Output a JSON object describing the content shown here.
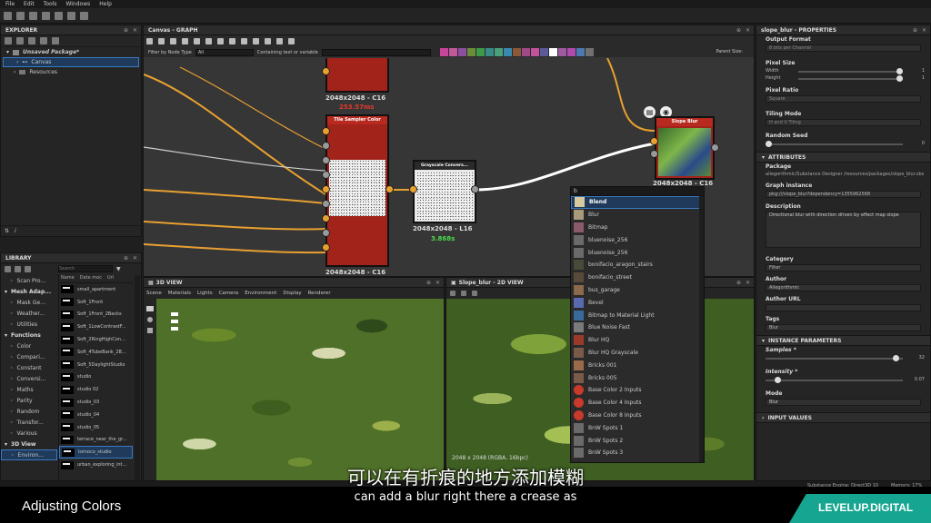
{
  "menu": [
    "File",
    "Edit",
    "Tools",
    "Windows",
    "Help"
  ],
  "explorer": {
    "title": "EXPLORER",
    "package": "Unsaved Package*",
    "items": [
      "Canvas",
      "Resources"
    ]
  },
  "library": {
    "title": "LIBRARY",
    "search_placeholder": "Search",
    "columns": [
      "Name",
      "Date moc",
      "Url"
    ],
    "categories": [
      {
        "label": "Scan Pro..."
      },
      {
        "label": "Mesh Adap...",
        "header": true
      },
      {
        "label": "Mask Ge..."
      },
      {
        "label": "Weather..."
      },
      {
        "label": "Utilities"
      },
      {
        "label": "Functions",
        "header": true
      },
      {
        "label": "Color"
      },
      {
        "label": "Compari..."
      },
      {
        "label": "Constant"
      },
      {
        "label": "Conversi..."
      },
      {
        "label": "Maths"
      },
      {
        "label": "Parity"
      },
      {
        "label": "Random"
      },
      {
        "label": "Transfor..."
      },
      {
        "label": "Various"
      },
      {
        "label": "3D View",
        "header": true
      },
      {
        "label": "Environ..."
      }
    ],
    "items": [
      "small_apartment",
      "Soft_1Front",
      "Soft_1Front_2Backs",
      "Soft_1LowContrastF...",
      "Soft_2RingHighCon...",
      "Soft_4TubeBank_2B...",
      "Soft_5DaylightStudio",
      "studio",
      "studio 02",
      "studio_03",
      "studio_04",
      "studio_05",
      "terrace_near_the_gr...",
      "tomoco_studio",
      "urban_exploring_int..."
    ]
  },
  "canvas": {
    "title": "Canvas - GRAPH",
    "filter_label": "Filter by Node Type",
    "filter_value": "All",
    "contains_label": "Containing text or variable",
    "parent_size": "Parent Size:",
    "nodes": {
      "top_res": "2048x2048 - C16",
      "top_time": "253.57ms",
      "tile_title": "Tile Sampler Color",
      "tile_res": "2048x2048 - C16",
      "gray_title": "Grayscale Convers...",
      "gray_res": "2048x2048 - L16",
      "gray_time": "3.868s",
      "slope_title": "Slope Blur",
      "slope_res": "2048x2048 - C16"
    },
    "toolbar_colors": [
      "#c7459a",
      "#c4589c",
      "#8e4fa0",
      "#6a8e3a",
      "#3c9a4a",
      "#3a8a8a",
      "#4aa07a",
      "#3a8ab0",
      "#8a5a3a",
      "#a04a8a",
      "#c4549a",
      "#5a5a9a",
      "#ffffff",
      "#a05aa0",
      "#b04ab0",
      "#4a7ab0",
      "#707070"
    ]
  },
  "view3d": {
    "title": "3D VIEW",
    "menu": [
      "Scene",
      "Materials",
      "Lights",
      "Camera",
      "Environment",
      "Display",
      "Renderer"
    ]
  },
  "view2d": {
    "title": "Slope_blur - 2D VIEW",
    "info": "2048 x 2048 (RGBA, 16bpc)"
  },
  "popup": {
    "search": "b",
    "items": [
      {
        "label": "Blend",
        "icon": "#d8c8a0",
        "selected": true
      },
      {
        "label": "Blur",
        "icon": "#a89a7a"
      },
      {
        "label": "Bitmap",
        "icon": "#8a5a6a"
      },
      {
        "label": "bluenoise_256",
        "icon": "#6a6a6a"
      },
      {
        "label": "bluenoise_256",
        "icon": "#6a6a6a"
      },
      {
        "label": "bonifacio_aragon_stairs",
        "icon": "#4a4a3a"
      },
      {
        "label": "bonifacio_street",
        "icon": "#5a4a3a"
      },
      {
        "label": "bus_garage",
        "icon": "#8a6a4a"
      },
      {
        "label": "Bevel",
        "icon": "#5a6ab0"
      },
      {
        "label": "Bitmap to Material Light",
        "icon": "#3a6a9a"
      },
      {
        "label": "Blue Noise Fast",
        "icon": "#7a7a7a"
      },
      {
        "label": "Blur HQ",
        "icon": "#9a3a2a"
      },
      {
        "label": "Blur HQ Grayscale",
        "icon": "#7a5a4a"
      },
      {
        "label": "Bricks 001",
        "icon": "#9a6a4a"
      },
      {
        "label": "Bricks 005",
        "icon": "#7a5a4a"
      },
      {
        "label": "Base Color 2 Inputs",
        "icon": "#c83a2a"
      },
      {
        "label": "Base Color 4 Inputs",
        "icon": "#c83a2a"
      },
      {
        "label": "Base Color 8 Inputs",
        "icon": "#c83a2a"
      },
      {
        "label": "BnW Spots 1",
        "icon": "#6a6a6a"
      },
      {
        "label": "BnW Spots 2",
        "icon": "#6a6a6a"
      },
      {
        "label": "BnW Spots 3",
        "icon": "#6a6a6a"
      }
    ]
  },
  "properties": {
    "title": "slope_blur - PROPERTIES",
    "output_format": "Output Format",
    "output_format_value": "8 bits per Channel",
    "pixel_size": "Pixel Size",
    "width_label": "Width",
    "width_value": "1",
    "height_label": "Height",
    "height_value": "1",
    "pixel_ratio": "Pixel Ratio",
    "pixel_ratio_value": "Square",
    "tiling_mode": "Tiling Mode",
    "tiling_mode_value": "H and V Tiling",
    "random_seed": "Random Seed",
    "random_seed_value": "0",
    "attributes": "ATTRIBUTES",
    "package_label": "Package",
    "package_value": "allegorithmic/Substance Designer /resources/packages/slope_blur.sbs",
    "graph_instance_label": "Graph instance",
    "graph_instance_value": "pkg:///slope_blur?dependency=1355962568",
    "description_label": "Description",
    "description_value": "Directional blur with direction driven by effect map slope",
    "category_label": "Category",
    "category_value": "Filter",
    "author_label": "Author",
    "author_value": "Allegorithmic",
    "author_url_label": "Author URL",
    "tags_label": "Tags",
    "tags_value": "Blur",
    "instance_params": "INSTANCE PARAMETERS",
    "samples_label": "Samples *",
    "samples_value": "32",
    "samples_fraction": 0.97,
    "intensity_label": "Intensity *",
    "intensity_value": "0.07",
    "intensity_fraction": 0.07,
    "mode_label": "Mode",
    "mode_value": "Blur",
    "input_values": "INPUT VALUES"
  },
  "status": {
    "engine": "Substance Engine: Direct3D 10",
    "memory": "Memory: 17%"
  },
  "overlay": {
    "subtitle_cn": "可以在有折痕的地方添加模糊",
    "subtitle_en": "can add a blur right there a crease as",
    "lesson": "Adjusting Colors",
    "brand": "LEVELUP.DIGITAL"
  }
}
